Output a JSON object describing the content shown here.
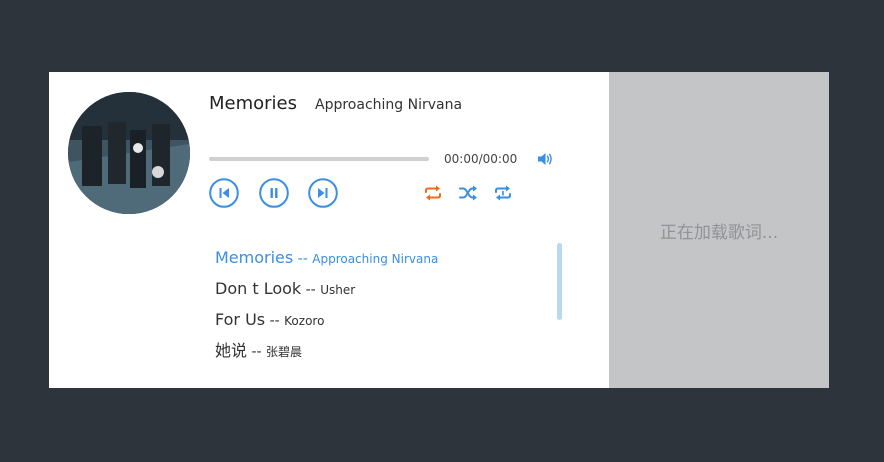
{
  "player": {
    "title": "Memories",
    "artist": "Approaching Nirvana",
    "time": "00:00/00:00",
    "progress": 0,
    "accent_color": "#3a8ee6",
    "loop_color": "#f06a1a",
    "controls": {
      "prev_icon": "skip-previous-icon",
      "play_pause_icon": "pause-icon",
      "next_icon": "skip-next-icon",
      "volume_icon": "volume-icon",
      "loop_icon": "repeat-icon",
      "shuffle_icon": "shuffle-icon",
      "single_icon": "repeat-one-icon"
    }
  },
  "playlist": [
    {
      "title": "Memories",
      "sep": " -- ",
      "artist": "Approaching Nirvana",
      "active": true
    },
    {
      "title": "Don t Look",
      "sep": " -- ",
      "artist": "Usher",
      "active": false
    },
    {
      "title": "For Us",
      "sep": " -- ",
      "artist": "Kozoro",
      "active": false
    },
    {
      "title": "她说",
      "sep": " -- ",
      "artist": "张碧晨",
      "active": false
    }
  ],
  "lyrics": {
    "loading_text": "正在加载歌词..."
  }
}
